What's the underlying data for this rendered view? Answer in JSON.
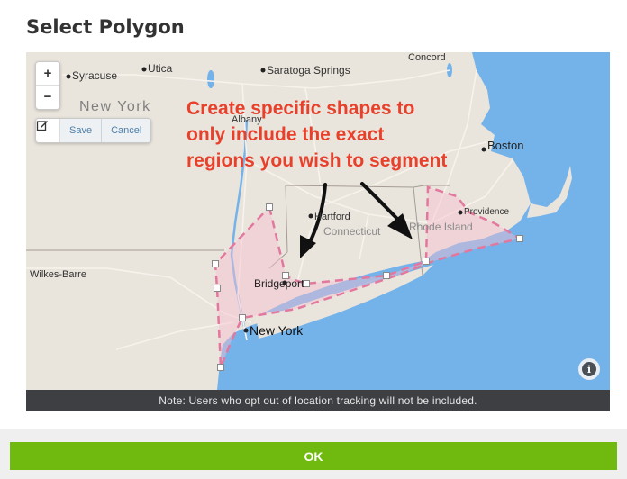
{
  "dialog": {
    "title": "Select Polygon",
    "ok_label": "OK"
  },
  "map": {
    "zoom_in": "+",
    "zoom_out": "−",
    "toolbar": {
      "save_label": "Save",
      "cancel_label": "Cancel",
      "edit_icon": "edit-icon"
    },
    "info_icon": "i",
    "note": "Note: Users who opt out of location tracking will not be included.",
    "annotation": {
      "line1": "Create specific shapes to",
      "line2": "only include the exact",
      "line3": "regions you wish to segment",
      "color": "#e8402a"
    },
    "place_labels": {
      "syracuse": "Syracuse",
      "utica": "Utica",
      "saratoga": "Saratoga Springs",
      "concord": "Concord",
      "new_york_state": "New York",
      "albany": "Albany",
      "boston": "Boston",
      "providence": "Providence",
      "hartford": "Hartford",
      "connecticut": "Connecticut",
      "rhode_island": "Rhode Island",
      "wilkes_barre": "Wilkes-Barre",
      "bridgeport": "Bridgeport",
      "new_york_city": "New York"
    },
    "colors": {
      "land": "#e9e4dc",
      "water": "#74b2ea",
      "polygon_stroke": "#e2789e",
      "polygon_fill": "#f6bfd0",
      "ok_green": "#70ba10"
    }
  }
}
